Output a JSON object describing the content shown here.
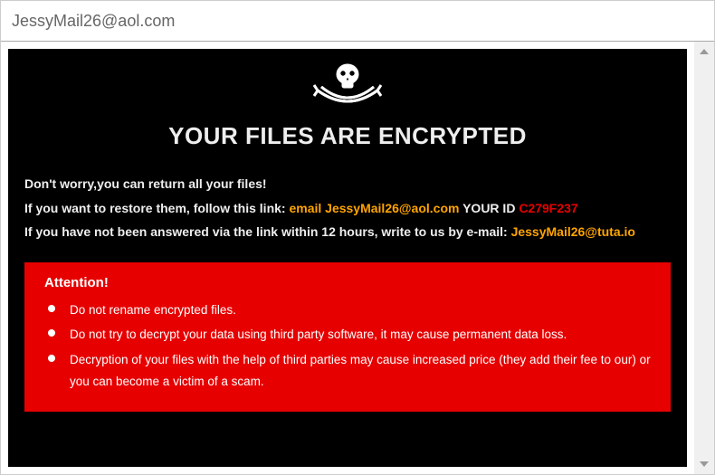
{
  "window": {
    "title": "JessyMail26@aol.com"
  },
  "ransom": {
    "headline": "YOUR FILES ARE ENCRYPTED",
    "line1": "Don't worry,you can return all your files!",
    "line2_prefix": "If you want to restore them, follow this link: ",
    "line2_emaillabel": "email JessyMail26@aol.com",
    "line2_idlabel": "  YOUR ID ",
    "line2_id": "C279F237",
    "line3_prefix": "If you have not been answered via the link within 12 hours, write to us by e-mail: ",
    "line3_email": "JessyMail26@tuta.io",
    "attention_title": "Attention!",
    "attention_items": [
      "Do not rename encrypted files.",
      "Do not try to decrypt your data using third party software, it may cause permanent data loss.",
      "Decryption of your files with the help of third parties may cause increased price (they add their fee to our) or you can become a victim of a scam."
    ]
  }
}
